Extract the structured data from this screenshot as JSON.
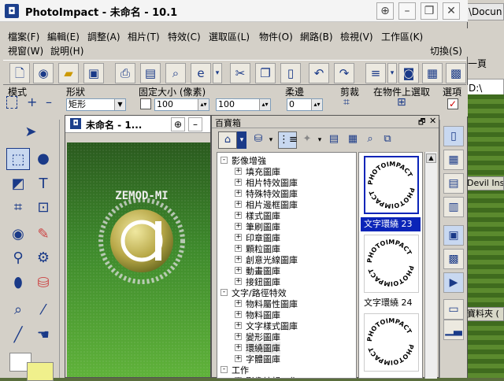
{
  "window": {
    "title": "PhotoImpact - 未命名 - 10.1"
  },
  "background": {
    "address_text": "\\Docun",
    "page_label": "一頁",
    "drive_text": "D:\\",
    "row_text_1": "Devil Insid",
    "row_text_2": "寶料夾 ("
  },
  "menu": {
    "row1": [
      "檔案(F)",
      "編輯(E)",
      "調整(A)",
      "相片(T)",
      "特效(C)",
      "選取區(L)",
      "物件(O)",
      "網路(B)",
      "檢視(V)",
      "工作區(K)"
    ],
    "row2": [
      "視窗(W)",
      "說明(H)"
    ],
    "switch_label": "切換(S)"
  },
  "attributes": {
    "mode_label": "模式",
    "shape_label": "形狀",
    "shape_value": "矩形",
    "fixed_size_label": "固定大小 (像素)",
    "width_value": "100",
    "height_value": "100",
    "soft_edge_label": "柔邊",
    "soft_edge_value": "0",
    "crop_label": "剪裁",
    "select_on_object_label": "在物件上選取",
    "options_label": "選項"
  },
  "document": {
    "title": "未命名 - 1...",
    "logo_text": "ZEMOD-MI"
  },
  "palette": {
    "title": "百寶箱",
    "tree": [
      {
        "label": "影像增強",
        "level": 0,
        "sign": "-"
      },
      {
        "label": "填充圖庫",
        "level": 1,
        "sign": "+"
      },
      {
        "label": "相片特效圖庫",
        "level": 1,
        "sign": "+"
      },
      {
        "label": "特殊特效圖庫",
        "level": 1,
        "sign": "+"
      },
      {
        "label": "相片邊框圖庫",
        "level": 1,
        "sign": "+"
      },
      {
        "label": "樣式圖庫",
        "level": 1,
        "sign": "+"
      },
      {
        "label": "筆刷圖庫",
        "level": 1,
        "sign": "+"
      },
      {
        "label": "印章圖庫",
        "level": 1,
        "sign": "+"
      },
      {
        "label": "顆粒圖庫",
        "level": 1,
        "sign": "+"
      },
      {
        "label": "創意光線圖庫",
        "level": 1,
        "sign": "+"
      },
      {
        "label": "動畫圖庫",
        "level": 1,
        "sign": "+"
      },
      {
        "label": "接鈕圖庫",
        "level": 1,
        "sign": "+"
      },
      {
        "label": "文字/路徑特效",
        "level": 0,
        "sign": "-"
      },
      {
        "label": "物料屬性圖庫",
        "level": 1,
        "sign": "+"
      },
      {
        "label": "物料圖庫",
        "level": 1,
        "sign": "+"
      },
      {
        "label": "文字樣式圖庫",
        "level": 1,
        "sign": "+"
      },
      {
        "label": "變形圖庫",
        "level": 1,
        "sign": "+"
      },
      {
        "label": "環繞圖庫",
        "level": 1,
        "sign": "+",
        "selected": true
      },
      {
        "label": "字體圖庫",
        "level": 1,
        "sign": "+"
      },
      {
        "label": "工作",
        "level": 0,
        "sign": "-"
      },
      {
        "label": "影像編輯工作",
        "level": 1,
        "sign": "+"
      }
    ],
    "gallery": [
      {
        "label": "文字環繞 23",
        "text": "PHOTOIMPACT",
        "selected": true
      },
      {
        "label": "文字環繞 24",
        "text": "PHOTOIMPACT",
        "selected": false
      },
      {
        "label": "",
        "text": "PHOTOIMPACT",
        "selected": false
      }
    ]
  },
  "colors": {
    "selection": "#0a24b8",
    "canvas_green": "#3e8a2c",
    "accent_blue": "#1a3a88"
  }
}
